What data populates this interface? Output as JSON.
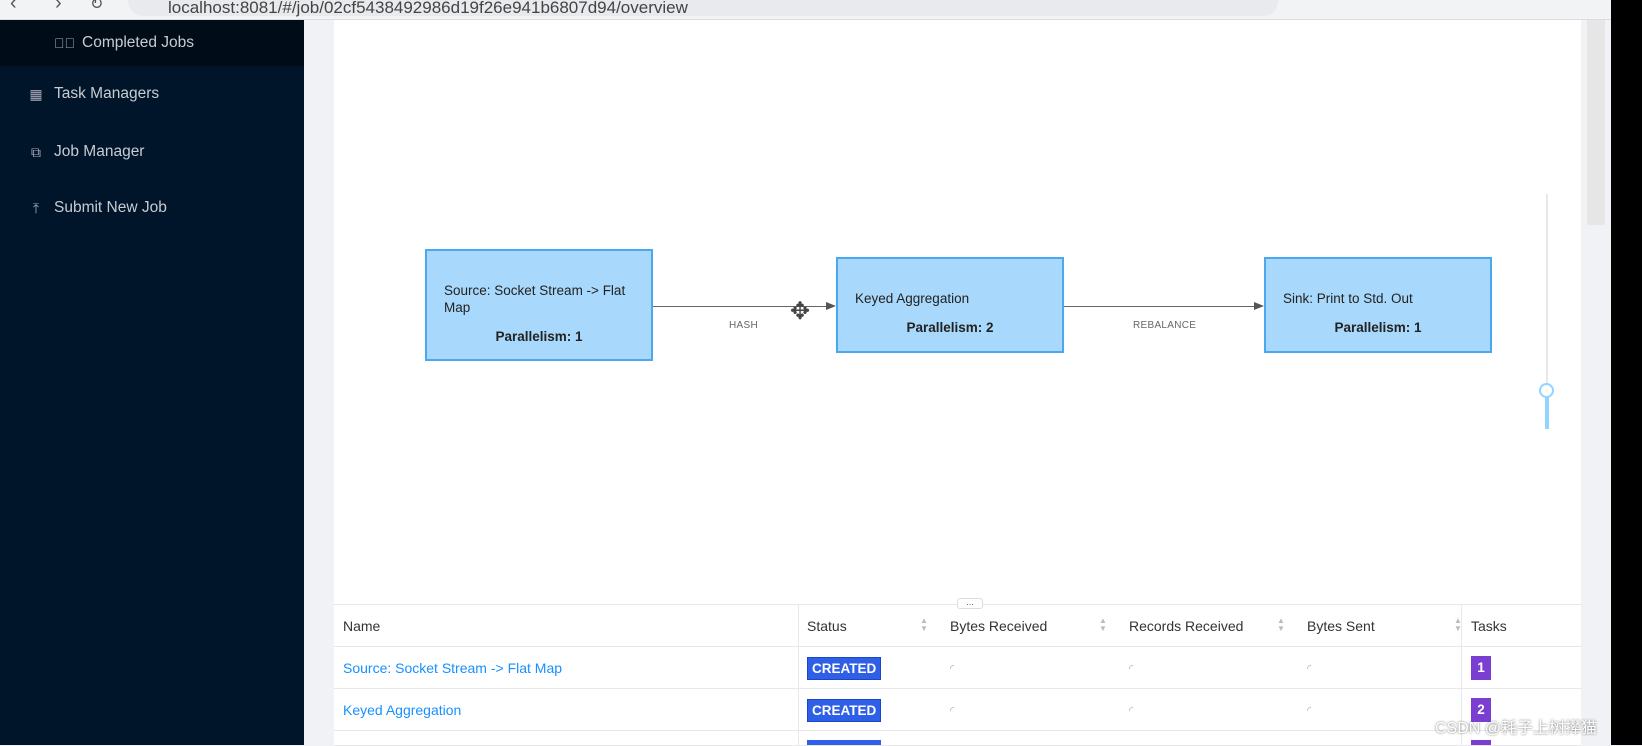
{
  "browser": {
    "url": "localhost:8081/#/job/02cf5438492986d19f26e941b6807d94/overview"
  },
  "sidebar": {
    "items": [
      {
        "label": "Completed Jobs",
        "icon": "check-circle-icon"
      },
      {
        "label": "Task Managers",
        "icon": "calendar-icon"
      },
      {
        "label": "Job Manager",
        "icon": "cluster-icon"
      },
      {
        "label": "Submit New Job",
        "icon": "upload-icon"
      }
    ]
  },
  "graph": {
    "nodes": [
      {
        "name": "Source: Socket Stream -> Flat Map",
        "parallelism": "Parallelism: 1"
      },
      {
        "name": "Keyed Aggregation",
        "parallelism": "Parallelism: 2"
      },
      {
        "name": "Sink: Print to Std. Out",
        "parallelism": "Parallelism: 1"
      }
    ],
    "edges": [
      {
        "label": "HASH"
      },
      {
        "label": "REBALANCE"
      }
    ],
    "zoom_level": 0.15
  },
  "table": {
    "resize_handle": "...",
    "headers": {
      "name": "Name",
      "status": "Status",
      "bytes_received": "Bytes Received",
      "records_received": "Records Received",
      "bytes_sent": "Bytes Sent",
      "tasks": "Tasks"
    },
    "rows": [
      {
        "name": "Source: Socket Stream -> Flat Map",
        "status": "CREATED",
        "tasks": "1"
      },
      {
        "name": "Keyed Aggregation",
        "status": "CREATED",
        "tasks": "2"
      }
    ],
    "colors": {
      "created": "#2f5fe6",
      "tasks": "#7a3fd0",
      "link": "#1890ff"
    }
  },
  "watermark": "CSDN @耗子上树撵猫"
}
